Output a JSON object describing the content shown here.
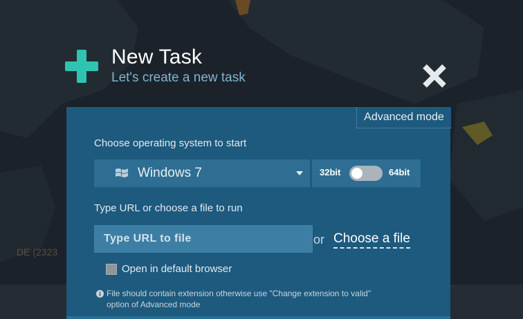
{
  "header": {
    "title": "New Task",
    "subtitle": "Let's create a new task"
  },
  "background": {
    "country_label": "DE (2323"
  },
  "panel": {
    "advanced_mode_label": "Advanced mode",
    "os_section_label": "Choose operating system to start",
    "os_selected": "Windows 7",
    "bit_left_label": "32bit",
    "bit_right_label": "64bit",
    "url_section_label": "Type URL or choose a file to run",
    "url_placeholder": "Type URL to file",
    "or_label": "or",
    "choose_file_label": "Choose a file",
    "open_browser_label": "Open in default browser",
    "note_line1": "File should contain extension otherwise use \"Change extension to valid\"",
    "note_line2": "option of Advanced mode"
  },
  "colors": {
    "accent_teal": "#2fc4b2",
    "panel_blue": "#1d5a7e",
    "field_blue": "#2e6e93"
  },
  "icons": {
    "plus": "plus-icon",
    "close": "close-icon",
    "windows": "windows-logo-icon",
    "dropdown": "chevron-down-icon",
    "info": "info-icon"
  }
}
